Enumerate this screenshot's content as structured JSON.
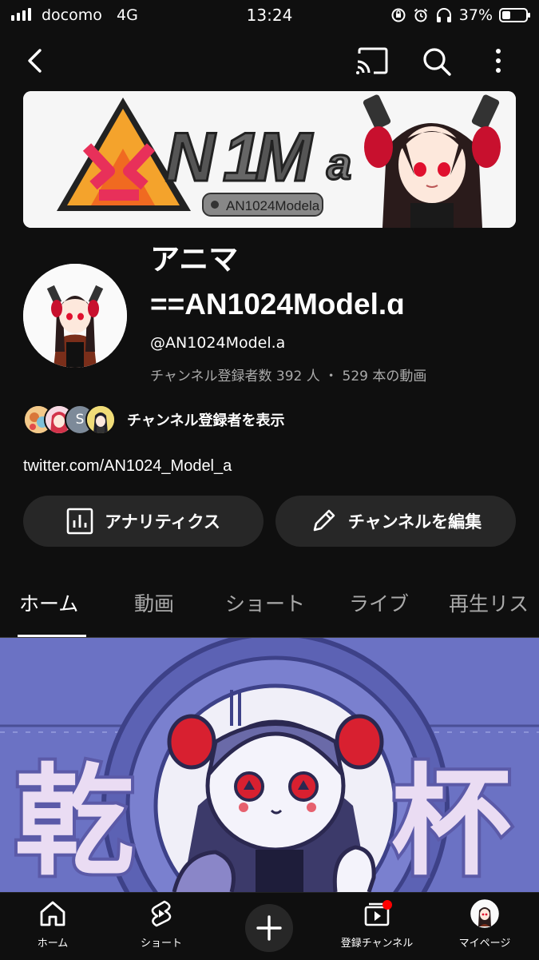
{
  "status_bar": {
    "carrier": "docomo",
    "network": "4G",
    "time": "13:24",
    "battery": "37%",
    "battery_level": 0.37
  },
  "top_bar": {
    "icons": [
      "back-arrow-icon",
      "cast-icon",
      "search-icon",
      "more-vert-icon"
    ]
  },
  "channel": {
    "title_line1": "アニマ",
    "title_line2": "==AN1024Model.ɑ",
    "handle": "@AN1024Model.a",
    "stats": "チャンネル登録者数 392 人 ・ 529 本の動画",
    "subscriber_link": "チャンネル登録者を表示",
    "subscriber_initial": "S",
    "external_link": "twitter.com/AN1024_Model_a",
    "banner_logo_text": "AN1024Modela"
  },
  "buttons": {
    "analytics": "アナリティクス",
    "edit_channel": "チャンネルを編集"
  },
  "tabs": [
    {
      "label": "ホーム",
      "active": true
    },
    {
      "label": "動画",
      "active": false
    },
    {
      "label": "ショート",
      "active": false
    },
    {
      "label": "ライブ",
      "active": false
    },
    {
      "label": "再生リス",
      "active": false
    }
  ],
  "featured": {
    "left_char": "乾",
    "right_char": "杯"
  },
  "bottom_nav": {
    "home": "ホーム",
    "shorts": "ショート",
    "subscriptions": "登録チャンネル",
    "you": "マイページ"
  },
  "colors": {
    "background": "#0f0f0f",
    "button_bg": "#272727",
    "secondary_text": "#aaaaaa",
    "accent_red": "#ff0000",
    "featured_bg": "#6b72c4"
  }
}
